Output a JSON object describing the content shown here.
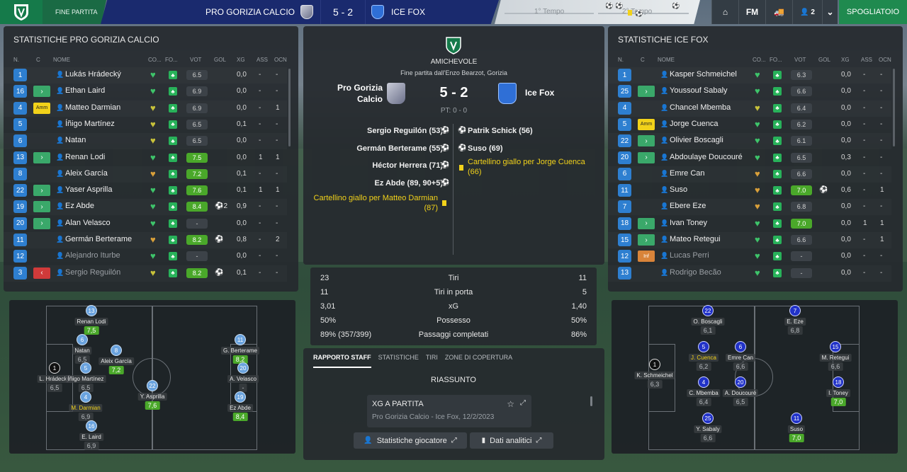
{
  "topbar": {
    "status": "FINE PARTITA",
    "home_team": "PRO GORIZIA CALCIO",
    "score": "5 - 2",
    "away_team": "ICE FOX",
    "first_half": "1° Tempo",
    "second_half": "2° Tempo",
    "fm_label": "FM",
    "squad_count": "2",
    "spogliatoio": "SPOGLIATOIO",
    "home_color": "#1a2a6e",
    "accent": "#1f8a4f"
  },
  "left_panel": {
    "title": "STATISTICHE PRO GORIZIA CALCIO",
    "headers": [
      "N.",
      "C",
      "NOME",
      "CO...",
      "FO...",
      "VOT",
      "GOL",
      "XG",
      "ASS",
      "OCN"
    ],
    "rows": [
      {
        "n": "1",
        "tag": "",
        "name": "Lukás Hrádecký",
        "vot": "6.5",
        "gol": "",
        "xg": "0,0",
        "ass": "-",
        "ocn": "-",
        "hi": false,
        "heart": "#3ec46a"
      },
      {
        "n": "16",
        "tag": "in",
        "name": "Ethan Laird",
        "vot": "6.9",
        "gol": "",
        "xg": "0,0",
        "ass": "-",
        "ocn": "-",
        "hi": false,
        "heart": "#3ec46a"
      },
      {
        "n": "4",
        "tag": "Amm",
        "name": "Matteo Darmian",
        "vot": "6.9",
        "gol": "",
        "xg": "0,0",
        "ass": "-",
        "ocn": "1",
        "hi": false,
        "heart": "#c8c23a"
      },
      {
        "n": "5",
        "tag": "",
        "name": "Íñigo Martínez",
        "vot": "6.5",
        "gol": "",
        "xg": "0,1",
        "ass": "-",
        "ocn": "-",
        "hi": false,
        "heart": "#c8c23a"
      },
      {
        "n": "6",
        "tag": "",
        "name": "Natan",
        "vot": "6.5",
        "gol": "",
        "xg": "0,0",
        "ass": "-",
        "ocn": "-",
        "hi": false,
        "heart": "#c8c23a"
      },
      {
        "n": "13",
        "tag": "in",
        "name": "Renan Lodi",
        "vot": "7.5",
        "gol": "",
        "xg": "0,0",
        "ass": "1",
        "ocn": "1",
        "hi": true,
        "heart": "#3ec46a"
      },
      {
        "n": "8",
        "tag": "",
        "name": "Aleix García",
        "vot": "7.2",
        "gol": "",
        "xg": "0,1",
        "ass": "-",
        "ocn": "-",
        "hi": true,
        "heart": "#d9a03a"
      },
      {
        "n": "22",
        "tag": "in",
        "name": "Yaser Asprilla",
        "vot": "7.6",
        "gol": "",
        "xg": "0,1",
        "ass": "1",
        "ocn": "1",
        "hi": true,
        "heart": "#3ec46a"
      },
      {
        "n": "19",
        "tag": "in",
        "name": "Ez Abde",
        "vot": "8.4",
        "gol": "⚽2",
        "xg": "0,9",
        "ass": "-",
        "ocn": "-",
        "hi": true,
        "heart": "#3ec46a"
      },
      {
        "n": "20",
        "tag": "in",
        "name": "Alan Velasco",
        "vot": "-",
        "gol": "",
        "xg": "0,0",
        "ass": "-",
        "ocn": "-",
        "hi": false,
        "heart": "#3ec46a"
      },
      {
        "n": "11",
        "tag": "",
        "name": "Germán Berterame",
        "vot": "8.2",
        "gol": "⚽",
        "xg": "0,8",
        "ass": "-",
        "ocn": "2",
        "hi": true,
        "heart": "#d9a03a"
      },
      {
        "n": "12",
        "tag": "",
        "name": "Alejandro Iturbe",
        "vot": "-",
        "gol": "",
        "xg": "0,0",
        "ass": "-",
        "ocn": "-",
        "hi": false,
        "heart": "#3ec46a",
        "dim": true
      },
      {
        "n": "3",
        "tag": "out",
        "name": "Sergio Reguilón",
        "vot": "8.2",
        "gol": "⚽",
        "xg": "0,1",
        "ass": "-",
        "ocn": "-",
        "hi": true,
        "heart": "#c8c23a",
        "dim": true
      }
    ]
  },
  "right_panel": {
    "title": "STATISTICHE ICE FOX",
    "headers": [
      "N.",
      "C",
      "NOME",
      "CO...",
      "FO...",
      "VOT",
      "GOL",
      "XG",
      "ASS",
      "OCN"
    ],
    "rows": [
      {
        "n": "1",
        "tag": "",
        "name": "Kasper Schmeichel",
        "vot": "6.3",
        "gol": "",
        "xg": "0,0",
        "ass": "-",
        "ocn": "-",
        "hi": false,
        "heart": "#3ec46a"
      },
      {
        "n": "25",
        "tag": "in",
        "name": "Youssouf Sabaly",
        "vot": "6.6",
        "gol": "",
        "xg": "0,0",
        "ass": "-",
        "ocn": "-",
        "hi": false,
        "heart": "#3ec46a"
      },
      {
        "n": "4",
        "tag": "",
        "name": "Chancel Mbemba",
        "vot": "6.4",
        "gol": "",
        "xg": "0,0",
        "ass": "-",
        "ocn": "-",
        "hi": false,
        "heart": "#c8c23a"
      },
      {
        "n": "5",
        "tag": "Amm",
        "name": "Jorge Cuenca",
        "vot": "6.2",
        "gol": "",
        "xg": "0,0",
        "ass": "-",
        "ocn": "-",
        "hi": false,
        "heart": "#3ec46a"
      },
      {
        "n": "22",
        "tag": "in",
        "name": "Olivier Boscagli",
        "vot": "6.1",
        "gol": "",
        "xg": "0,0",
        "ass": "-",
        "ocn": "-",
        "hi": false,
        "heart": "#3ec46a"
      },
      {
        "n": "20",
        "tag": "in",
        "name": "Abdoulaye Doucouré",
        "vot": "6.5",
        "gol": "",
        "xg": "0,3",
        "ass": "-",
        "ocn": "-",
        "hi": false,
        "heart": "#3ec46a"
      },
      {
        "n": "6",
        "tag": "",
        "name": "Emre Can",
        "vot": "6.6",
        "gol": "",
        "xg": "0,0",
        "ass": "-",
        "ocn": "-",
        "hi": false,
        "heart": "#d9a03a"
      },
      {
        "n": "11",
        "tag": "",
        "name": "Suso",
        "vot": "7.0",
        "gol": "⚽",
        "xg": "0,6",
        "ass": "-",
        "ocn": "1",
        "hi": true,
        "heart": "#d9a03a"
      },
      {
        "n": "7",
        "tag": "",
        "name": "Ebere Eze",
        "vot": "6.8",
        "gol": "",
        "xg": "0,0",
        "ass": "-",
        "ocn": "-",
        "hi": false,
        "heart": "#d9a03a"
      },
      {
        "n": "18",
        "tag": "in",
        "name": "Ivan Toney",
        "vot": "7.0",
        "gol": "",
        "xg": "0,0",
        "ass": "1",
        "ocn": "1",
        "hi": true,
        "heart": "#3ec46a"
      },
      {
        "n": "15",
        "tag": "in",
        "name": "Mateo Retegui",
        "vot": "6.6",
        "gol": "",
        "xg": "0,0",
        "ass": "-",
        "ocn": "1",
        "hi": false,
        "heart": "#3ec46a"
      },
      {
        "n": "12",
        "tag": "Inf",
        "name": "Lucas Perri",
        "vot": "-",
        "gol": "",
        "xg": "0,0",
        "ass": "-",
        "ocn": "-",
        "hi": false,
        "heart": "#3ec46a",
        "dim": true
      },
      {
        "n": "13",
        "tag": "",
        "name": "Rodrigo Becão",
        "vot": "-",
        "gol": "",
        "xg": "0,0",
        "ass": "-",
        "ocn": "-",
        "hi": false,
        "heart": "#3ec46a",
        "dim": true
      }
    ]
  },
  "match": {
    "competition": "AMICHEVOLE",
    "venue": "Fine partita dall'Enzo Bearzot, Gorizia",
    "home": "Pro Gorizia Calcio",
    "away": "Ice Fox",
    "score": "5 - 2",
    "pt": "PT: 0 - 0",
    "home_events": [
      "Sergio Reguilón (53)",
      "Germán Berterame (55)",
      "Héctor Herrera (71)",
      "Ez Abde (89, 90+5)"
    ],
    "home_card": "Cartellino giallo per Matteo Darmian (87)",
    "away_events": [
      "Patrik Schick (56)",
      "Suso (69)"
    ],
    "away_card": "Cartellino giallo per Jorge Cuenca (66)"
  },
  "stats": [
    {
      "home": "23",
      "label": "Tiri",
      "away": "11"
    },
    {
      "home": "11",
      "label": "Tiri in porta",
      "away": "5"
    },
    {
      "home": "3,01",
      "label": "xG",
      "away": "1,40"
    },
    {
      "home": "50%",
      "label": "Possesso",
      "away": "50%"
    },
    {
      "home": "89% (357/399)",
      "label": "Passaggi completati",
      "away": "86%"
    }
  ],
  "tabs": [
    "RAPPORTO STAFF",
    "STATISTICHE",
    "TIRI",
    "ZONE DI COPERTURA"
  ],
  "summary": {
    "title": "RIASSUNTO",
    "card_title": "XG A PARTITA",
    "card_sub": "Pro Gorizia Calcio - Ice Fox, 12/2/2023"
  },
  "buttons": {
    "player_stats": "Statistiche giocatore",
    "analytics": "Dati analitici"
  },
  "home_formation": [
    {
      "n": "13",
      "name": "Renan Lodi",
      "rating": "7,5",
      "g": true
    },
    {
      "n": "6",
      "name": "Natan",
      "rating": "6,5",
      "g": false
    },
    {
      "n": "8",
      "name": "Aleix García",
      "rating": "7,2",
      "g": true
    },
    {
      "n": "1",
      "name": "L. Hrádecký",
      "rating": "6,5",
      "g": false
    },
    {
      "n": "5",
      "name": "Íñigo Martínez",
      "rating": "6,5",
      "g": false
    },
    {
      "n": "22",
      "name": "Y. Asprilla",
      "rating": "7,6",
      "g": true
    },
    {
      "n": "4",
      "name": "M. Darmian",
      "rating": "6,9",
      "g": false,
      "y": true
    },
    {
      "n": "16",
      "name": "E. Laird",
      "rating": "6,9",
      "g": false
    },
    {
      "n": "11",
      "name": "G. Berterame",
      "rating": "8,2",
      "g": true
    },
    {
      "n": "20",
      "name": "A. Velasco",
      "rating": "-",
      "g": false
    },
    {
      "n": "19",
      "name": "Ez Abde",
      "rating": "8,4",
      "g": true
    }
  ],
  "away_formation": [
    {
      "n": "22",
      "name": "O. Boscagli",
      "rating": "6,1",
      "g": false
    },
    {
      "n": "7",
      "name": "E. Eze",
      "rating": "6,8",
      "g": false
    },
    {
      "n": "1",
      "name": "K. Schmeichel",
      "rating": "6,3",
      "g": false
    },
    {
      "n": "5",
      "name": "J. Cuenca",
      "rating": "6,2",
      "g": false,
      "y": true
    },
    {
      "n": "6",
      "name": "Emre Can",
      "rating": "6,6",
      "g": false
    },
    {
      "n": "20",
      "name": "A. Doucouré",
      "rating": "6,5",
      "g": false
    },
    {
      "n": "4",
      "name": "C. Mbemba",
      "rating": "6,4",
      "g": false
    },
    {
      "n": "15",
      "name": "M. Retegui",
      "rating": "6,6",
      "g": false
    },
    {
      "n": "18",
      "name": "I. Toney",
      "rating": "7,0",
      "g": true
    },
    {
      "n": "25",
      "name": "Y. Sabaly",
      "rating": "6,6",
      "g": false
    },
    {
      "n": "11",
      "name": "Suso",
      "rating": "7,0",
      "g": true
    }
  ]
}
